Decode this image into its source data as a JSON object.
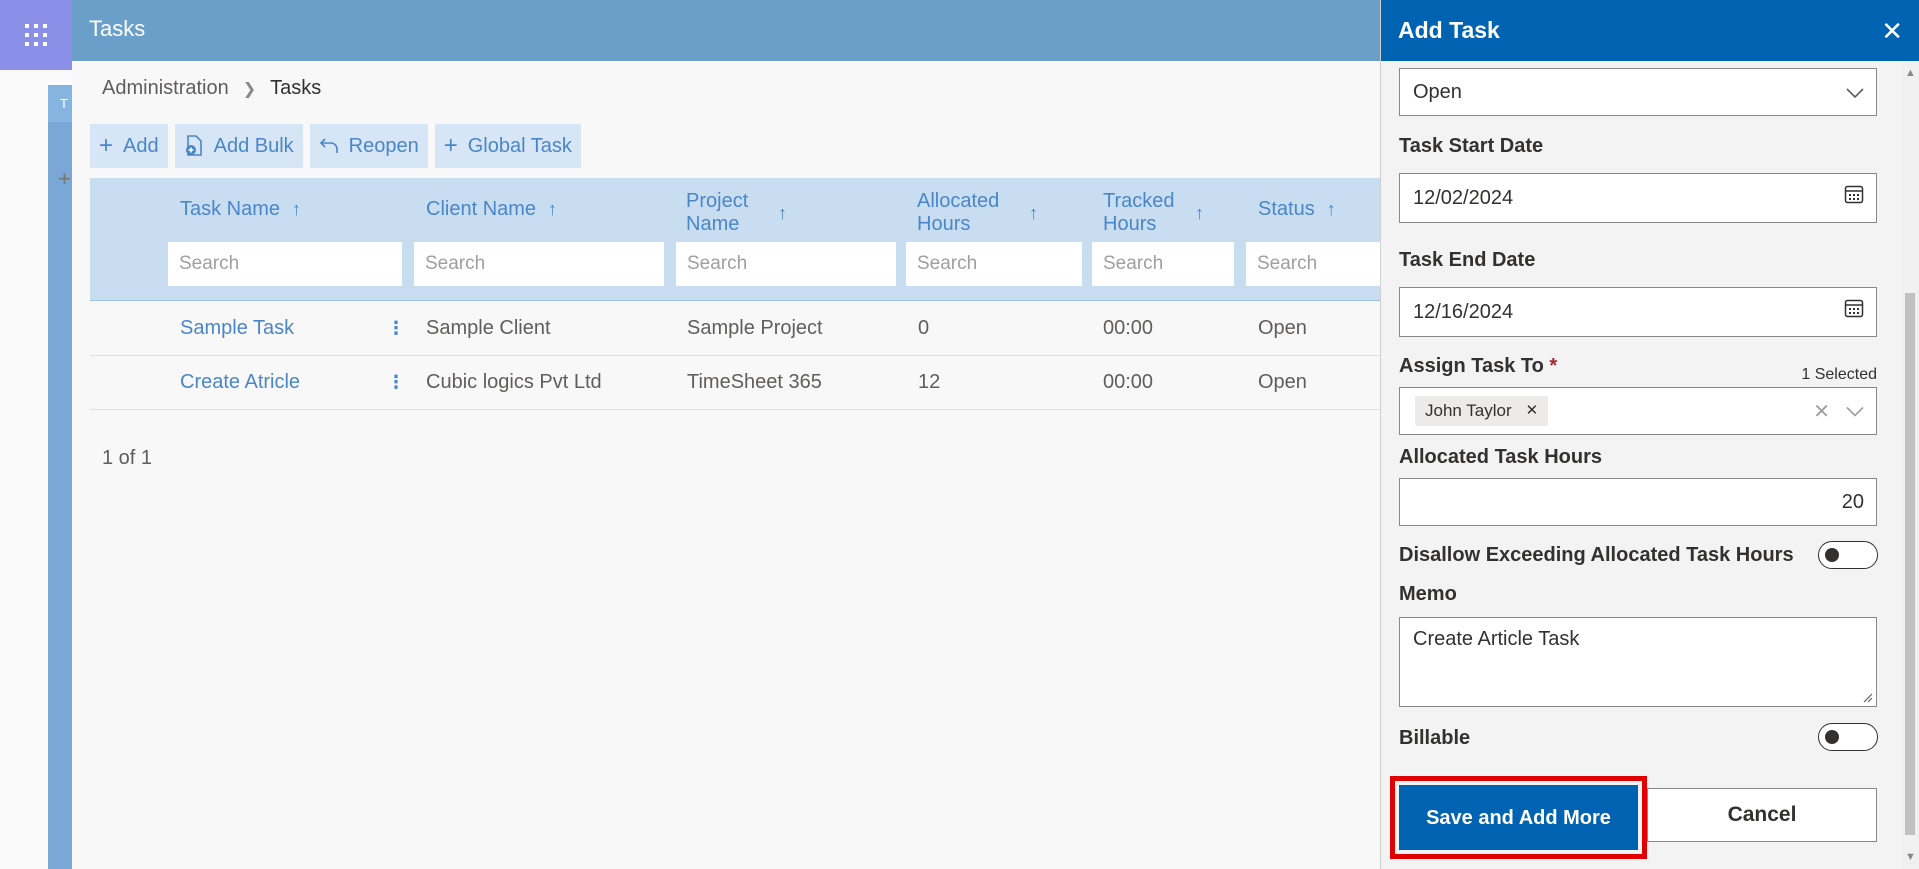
{
  "main": {
    "title": "Tasks",
    "breadcrumb": [
      "Administration",
      "Tasks"
    ],
    "toolbar": [
      {
        "label": "Add",
        "icon": "plus-icon"
      },
      {
        "label": "Add Bulk",
        "icon": "add-file-icon"
      },
      {
        "label": "Reopen",
        "icon": "undo-icon"
      },
      {
        "label": "Global Task",
        "icon": "plus-icon"
      }
    ],
    "columns": [
      {
        "label": "Task Name",
        "search": "Search"
      },
      {
        "label": "Client Name",
        "search": "Search"
      },
      {
        "label": "Project Name",
        "search": "Search"
      },
      {
        "label": "Allocated Hours",
        "search": "Search"
      },
      {
        "label": "Tracked Hours",
        "search": "Search"
      },
      {
        "label": "Status",
        "search": "Search"
      }
    ],
    "rows": [
      {
        "task": "Sample Task",
        "client": "Sample Client",
        "project": "Sample Project",
        "allocated": "0",
        "tracked": "00:00",
        "status": "Open"
      },
      {
        "task": "Create Atricle",
        "client": "Cubic logics Pvt Ltd",
        "project": "TimeSheet 365",
        "allocated": "12",
        "tracked": "00:00",
        "status": "Open"
      }
    ],
    "pager": "1 of 1"
  },
  "panel": {
    "title": "Add Task",
    "status_value": "Open",
    "start_label": "Task Start Date",
    "start_value": "12/02/2024",
    "end_label": "Task End Date",
    "end_value": "12/16/2024",
    "assign_label": "Assign Task To",
    "assign_required": "*",
    "assign_count": "1 Selected",
    "assign_tag": "John Taylor",
    "hours_label": "Allocated Task Hours",
    "hours_value": "20",
    "disallow_label": "Disallow Exceeding Allocated Task Hours",
    "disallow_on": false,
    "memo_label": "Memo",
    "memo_value": "Create Article Task",
    "billable_label": "Billable",
    "billable_on": false,
    "save_label": "Save and Add More",
    "cancel_label": "Cancel"
  },
  "colors": {
    "accent": "#0063b1",
    "header": "#6a9fca",
    "link": "#4a86c8",
    "highlight": "#e00000"
  }
}
